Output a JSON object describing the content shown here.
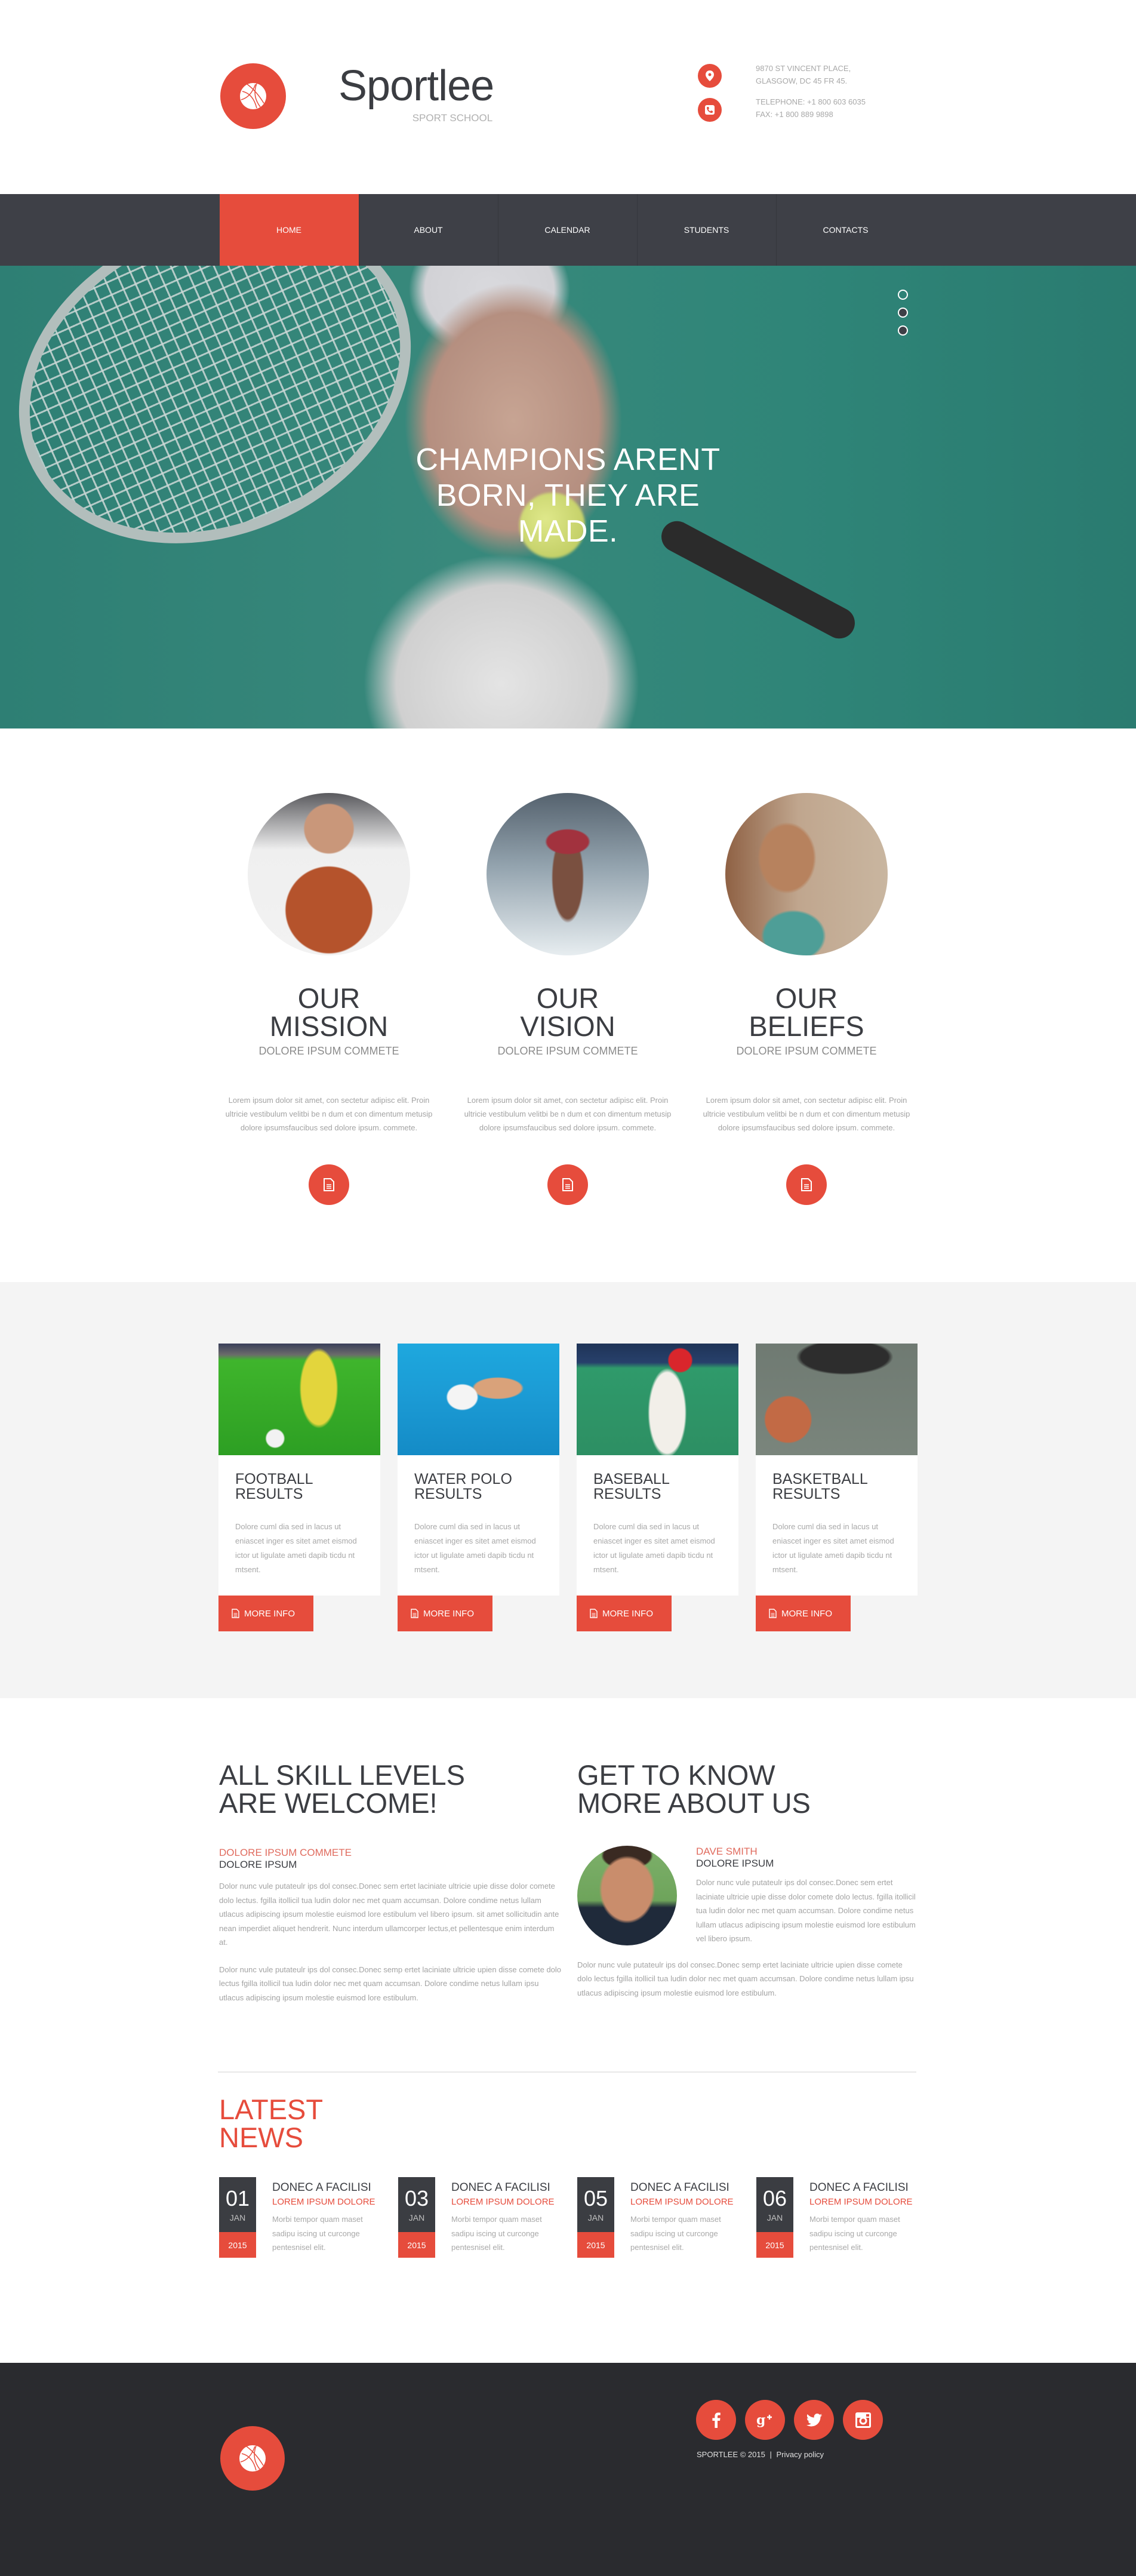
{
  "colors": {
    "accent": "#e64c3c",
    "dark": "#3e4047",
    "footer": "#2a2b2f",
    "light_gray": "#f4f4f4"
  },
  "header": {
    "brand_name": "Sportlee",
    "brand_tagline": "SPORT SCHOOL",
    "logo_icon": "basketball-icon",
    "address_icon": "map-pin-icon",
    "address_line1": "9870 ST VINCENT PLACE,",
    "address_line2": "GLASGOW, DC 45 FR 45.",
    "phone_icon": "phone-icon",
    "telephone": "TELEPHONE: +1 800 603 6035",
    "fax": "FAX: +1 800 889 9898"
  },
  "nav": {
    "items": [
      {
        "label": "HOME",
        "active": true
      },
      {
        "label": "ABOUT",
        "active": false
      },
      {
        "label": "CALENDAR",
        "active": false
      },
      {
        "label": "STUDENTS",
        "active": false
      },
      {
        "label": "CONTACTS",
        "active": false
      }
    ]
  },
  "hero": {
    "line1": "CHAMPIONS ARENT",
    "line2": "BORN, THEY ARE",
    "line3": "MADE.",
    "slide_count": 3,
    "active_slide": 1,
    "image": "tennis player woman holding ball and racket"
  },
  "features": [
    {
      "title1": "OUR",
      "title2": "MISSION",
      "sub": "DOLORE IPSUM COMMETE",
      "text": "Lorem ipsum dolor sit amet, con sectetur adipisc elit. Proin ultricie vestibulum velitbi be n dum et con dimentum metusip dolore ipsumsfaucibus sed dolore ipsum. commete.",
      "image": "man holding basketball",
      "icon": "document-icon"
    },
    {
      "title1": "OUR",
      "title2": "VISION",
      "sub": "DOLORE IPSUM COMMETE",
      "text": "Lorem ipsum dolor sit amet, con sectetur adipisc elit. Proin ultricie vestibulum velitbi be n dum et con dimentum metusip dolore ipsumsfaucibus sed dolore ipsum. commete.",
      "image": "athlete jumping against sky",
      "icon": "document-icon"
    },
    {
      "title1": "OUR",
      "title2": "BELIEFS",
      "sub": "DOLORE IPSUM COMMETE",
      "text": "Lorem ipsum dolor sit amet, con sectetur adipisc elit. Proin ultricie vestibulum velitbi be n dum et con dimentum metusip dolore ipsumsfaucibus sed dolore ipsum. commete.",
      "image": "woman flexing arm",
      "icon": "document-icon"
    }
  ],
  "results": [
    {
      "title1": "FOOTBALL",
      "title2": "RESULTS",
      "text": "Dolore cuml dia sed in lacus ut eniascet inger es sitet amet eismod ictor ut ligulate ameti dapib ticdu nt mtsent.",
      "button": "MORE INFO",
      "image": "football player kicking ball"
    },
    {
      "title1": "WATER POLO",
      "title2": "RESULTS",
      "text": "Dolore cuml dia sed in lacus ut eniascet inger es sitet amet eismod ictor ut ligulate ameti dapib ticdu nt mtsent.",
      "button": "MORE INFO",
      "image": "water polo swimmer"
    },
    {
      "title1": "BASEBALL",
      "title2": "RESULTS",
      "text": "Dolore cuml dia sed in lacus ut eniascet inger es sitet amet eismod ictor ut ligulate ameti dapib ticdu nt mtsent.",
      "button": "MORE INFO",
      "image": "baseball batter"
    },
    {
      "title1": "BASKETBALL",
      "title2": "RESULTS",
      "text": "Dolore cuml dia sed in lacus ut eniascet inger es sitet amet eismod ictor ut ligulate ameti dapib ticdu nt mtsent.",
      "button": "MORE INFO",
      "image": "basketball dribble on court"
    }
  ],
  "skills": {
    "title1": "ALL SKILL LEVELS",
    "title2": "ARE WELCOME!",
    "accent_sub": "DOLORE IPSUM COMMETE",
    "dark_sub": "DOLORE IPSUM",
    "para1": "Dolor nunc vule putateulr ips dol consec.Donec sem ertet laciniate ultricie upie disse dolor comete dolo lectus. fgilla itollicil tua ludin dolor nec met quam accumsan. Dolore condime netus lullam utlacus adipiscing ipsum molestie euismod lore estibulum vel libero ipsum. sit amet sollicitudin ante nean imperdiet aliquet hendrerit. Nunc interdum ullamcorper lectus,et pellentesque enim interdum at.",
    "para2": "Dolor nunc vule putateulr ips dol consec.Donec semp ertet laciniate ultricie upien disse comete dolo lectus fgilla itollicil tua ludin dolor nec met quam accumsan. Dolore condime netus lullam ipsu utlacus adipiscing ipsum molestie euismod lore estibulum."
  },
  "about": {
    "title1": "GET TO KNOW",
    "title2": "MORE ABOUT US",
    "person_name": "DAVE SMITH",
    "person_role": "DOLORE IPSUM",
    "person_image": "portrait of man in tank top",
    "bio": "Dolor nunc vule putateulr ips dol consec.Donec sem ertet laciniate ultricie upie disse dolor comete dolo lectus. fgilla itollicil tua ludin dolor nec met quam accumsan. Dolore condime netus lullam utlacus adipiscing ipsum molestie euismod lore estibulum vel libero ipsum.",
    "para": "Dolor nunc vule putateulr ips dol consec.Donec semp ertet laciniate ultricie upien disse comete dolo lectus fgilla itollicil tua ludin dolor nec met quam accumsan. Dolore condime netus lullam ipsu utlacus adipiscing ipsum molestie euismod lore estibulum."
  },
  "news": {
    "title1": "LATEST",
    "title2": "NEWS",
    "items": [
      {
        "day": "01",
        "month": "JAN",
        "year": "2015",
        "title": "DONEC A FACILISI",
        "sub": "LOREM IPSUM DOLORE",
        "text": "Morbi tempor quam maset sadipu iscing ut curconge pentesnisel elit."
      },
      {
        "day": "03",
        "month": "JAN",
        "year": "2015",
        "title": "DONEC A FACILISI",
        "sub": "LOREM IPSUM DOLORE",
        "text": "Morbi tempor quam maset sadipu iscing ut curconge pentesnisel elit."
      },
      {
        "day": "05",
        "month": "JAN",
        "year": "2015",
        "title": "DONEC A FACILISI",
        "sub": "LOREM IPSUM DOLORE",
        "text": "Morbi tempor quam maset sadipu iscing ut curconge pentesnisel elit."
      },
      {
        "day": "06",
        "month": "JAN",
        "year": "2015",
        "title": "DONEC A FACILISI",
        "sub": "LOREM IPSUM DOLORE",
        "text": "Morbi tempor quam maset sadipu iscing ut curconge pentesnisel elit."
      }
    ]
  },
  "footer": {
    "socials": [
      {
        "name": "facebook",
        "glyph": "f"
      },
      {
        "name": "google-plus",
        "glyph": "g+"
      },
      {
        "name": "twitter",
        "glyph": "twitter"
      },
      {
        "name": "instagram",
        "glyph": "instagram"
      }
    ],
    "copyright": "SPORTLEE © 2015",
    "separator": "|",
    "privacy": "Privacy policy"
  }
}
